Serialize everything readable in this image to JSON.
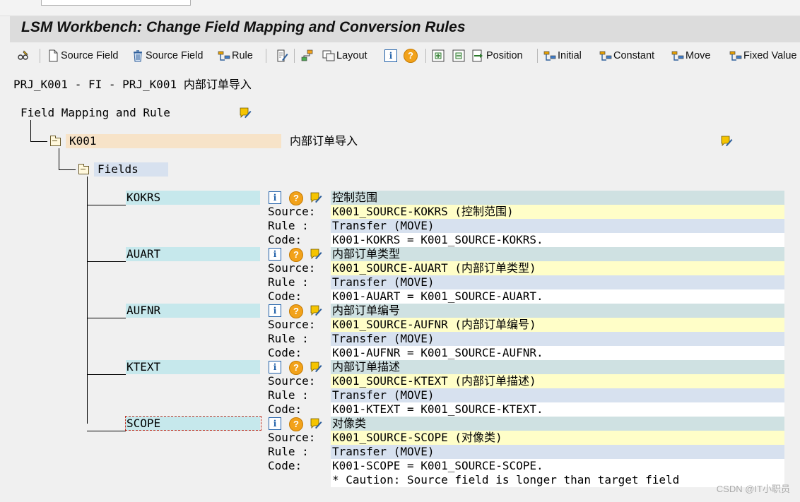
{
  "window": {
    "title": "LSM Workbench: Change Field Mapping and Conversion Rules"
  },
  "toolbar": {
    "create_source_field": "Source Field",
    "delete_source_field": "Source Field",
    "rule": "Rule",
    "layout": "Layout",
    "position": "Position",
    "initial": "Initial",
    "constant": "Constant",
    "move": "Move",
    "fixed_value": "Fixed Value"
  },
  "header": {
    "object_path": "PRJ_K001 - FI - PRJ_K001 内部订单导入"
  },
  "tree": {
    "root_label": "Field Mapping and Rule",
    "structure": {
      "name": "K001",
      "description": "内部订单导入"
    },
    "fields_node": "Fields",
    "row_labels": {
      "source": "Source:",
      "rule": "Rule :",
      "code": "Code:"
    },
    "items": [
      {
        "name": "KOKRS",
        "description": "控制范围",
        "source": "K001_SOURCE-KOKRS (控制范围)",
        "rule": "Transfer (MOVE)",
        "code": "K001-KOKRS = K001_SOURCE-KOKRS."
      },
      {
        "name": "AUART",
        "description": "内部订单类型",
        "source": "K001_SOURCE-AUART (内部订单类型)",
        "rule": "Transfer (MOVE)",
        "code": "K001-AUART = K001_SOURCE-AUART."
      },
      {
        "name": "AUFNR",
        "description": "内部订单编号",
        "source": "K001_SOURCE-AUFNR (内部订单编号)",
        "rule": "Transfer (MOVE)",
        "code": "K001-AUFNR = K001_SOURCE-AUFNR."
      },
      {
        "name": "KTEXT",
        "description": "内部订单描述",
        "source": "K001_SOURCE-KTEXT (内部订单描述)",
        "rule": "Transfer (MOVE)",
        "code": "K001-KTEXT = K001_SOURCE-KTEXT."
      },
      {
        "name": "SCOPE",
        "description": "对像类",
        "source": "K001_SOURCE-SCOPE (对像类)",
        "rule": "Transfer (MOVE)",
        "code": "K001-SCOPE = K001_SOURCE-SCOPE.",
        "note": "* Caution: Source field is longer than target field"
      }
    ]
  },
  "watermark": "CSDN @IT小职员",
  "colors": {
    "field_name_bg": "#c6e8ec",
    "description_bg": "#cfe1e2",
    "source_bg": "#fffec8",
    "rule_bg": "#d7e1ef",
    "code_bg": "#ffffff",
    "structure_bg": "#f7e3c8",
    "fields_node_bg": "#d7e1ef"
  }
}
